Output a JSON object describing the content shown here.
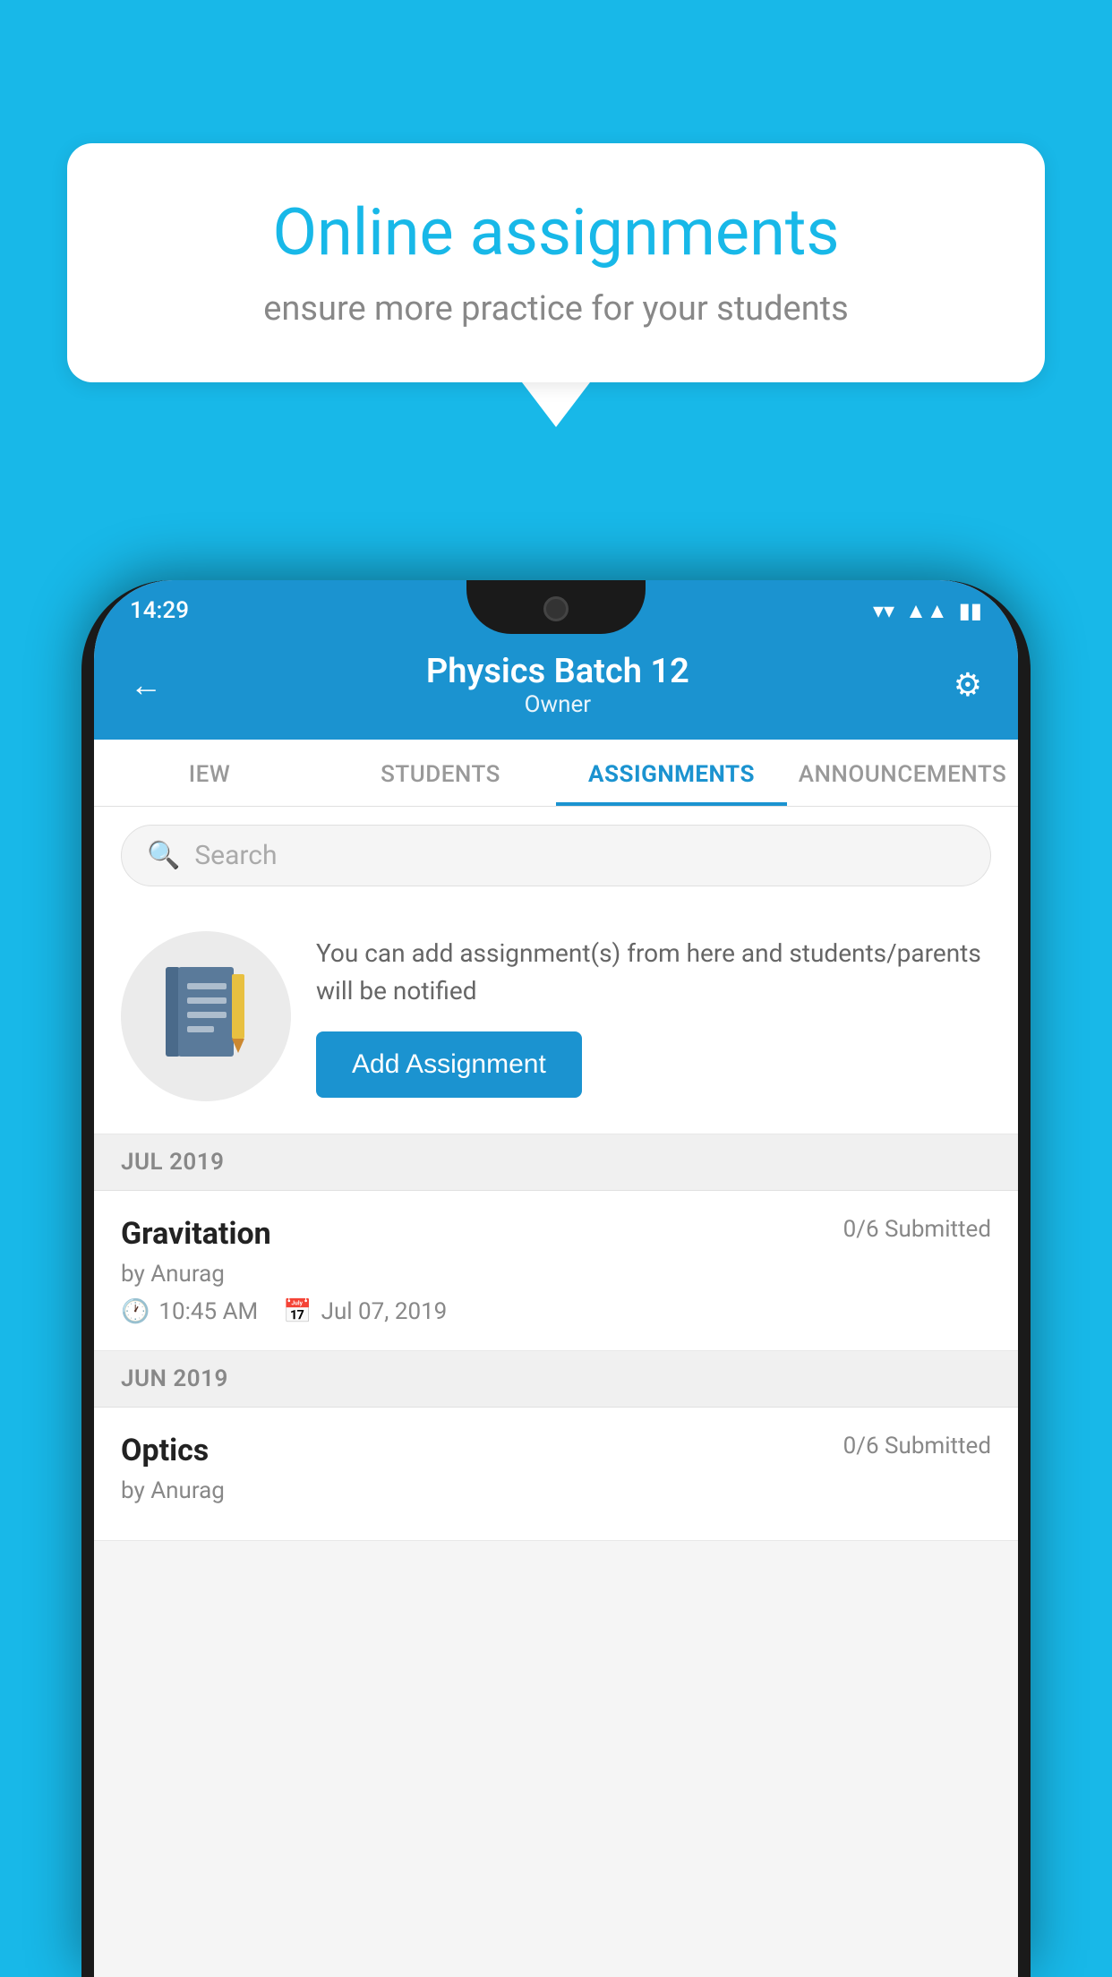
{
  "background": {
    "color": "#18b8e8"
  },
  "speech_bubble": {
    "title": "Online assignments",
    "subtitle": "ensure more practice for your students"
  },
  "phone": {
    "status_bar": {
      "time": "14:29",
      "icons": [
        "wifi",
        "signal",
        "battery"
      ]
    },
    "header": {
      "title": "Physics Batch 12",
      "subtitle": "Owner",
      "back_label": "←",
      "settings_label": "⚙"
    },
    "tabs": [
      {
        "label": "IEW",
        "active": false
      },
      {
        "label": "STUDENTS",
        "active": false
      },
      {
        "label": "ASSIGNMENTS",
        "active": true
      },
      {
        "label": "ANNOUNCEMENTS",
        "active": false
      }
    ],
    "search": {
      "placeholder": "Search"
    },
    "promo": {
      "description": "You can add assignment(s) from here and students/parents will be notified",
      "button_label": "Add Assignment"
    },
    "sections": [
      {
        "month": "JUL 2019",
        "assignments": [
          {
            "title": "Gravitation",
            "submitted": "0/6 Submitted",
            "author": "by Anurag",
            "time": "10:45 AM",
            "date": "Jul 07, 2019"
          }
        ]
      },
      {
        "month": "JUN 2019",
        "assignments": [
          {
            "title": "Optics",
            "submitted": "0/6 Submitted",
            "author": "by Anurag",
            "time": "",
            "date": ""
          }
        ]
      }
    ]
  }
}
